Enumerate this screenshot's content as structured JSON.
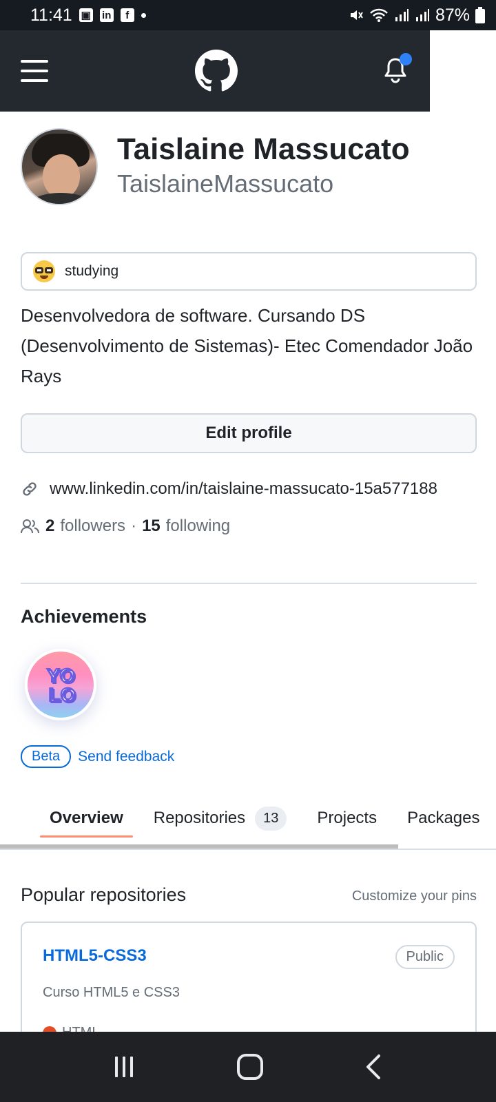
{
  "status_bar": {
    "time": "11:41",
    "apps": [
      "image-icon",
      "linkedin-icon",
      "facebook-icon"
    ],
    "battery": "87%"
  },
  "header": {
    "menu_icon": "hamburger-icon",
    "logo_icon": "github-octocat-icon",
    "notification_icon": "bell-icon",
    "notification_dot_color": "#2f81f7"
  },
  "profile": {
    "name": "Taislaine Massucato",
    "login": "TaislaineMassucato",
    "status_emoji": "nerd-face-emoji",
    "status_text": "studying",
    "bio": "Desenvolvedora de software. Cursando DS (Desenvolvimento de Sistemas)- Etec Comendador João Rays",
    "edit_label": "Edit profile",
    "website": "www.linkedin.com/in/taislaine-massucato-15a577188",
    "followers_count": "2",
    "followers_label": "followers",
    "separator": "·",
    "following_count": "15",
    "following_label": "following"
  },
  "achievements": {
    "title": "Achievements",
    "badge_icon": "yolo-badge-icon",
    "beta_label": "Beta",
    "feedback_label": "Send feedback"
  },
  "tabs": [
    {
      "label": "Overview",
      "active": true
    },
    {
      "label": "Repositories",
      "count": "13"
    },
    {
      "label": "Projects"
    },
    {
      "label": "Packages"
    }
  ],
  "popular": {
    "title": "Popular repositories",
    "customize_label": "Customize your pins",
    "repos": [
      {
        "name": "HTML5-CSS3",
        "visibility": "Public",
        "description": "Curso HTML5 e CSS3",
        "language": "HTML",
        "language_color": "#e34c26"
      }
    ]
  },
  "nav_bar": {
    "recents_icon": "recents-icon",
    "home_icon": "home-icon",
    "back_icon": "back-icon"
  },
  "colors": {
    "header_bg": "#24292f",
    "link": "#0969da",
    "tab_underline": "#fd8c73"
  }
}
